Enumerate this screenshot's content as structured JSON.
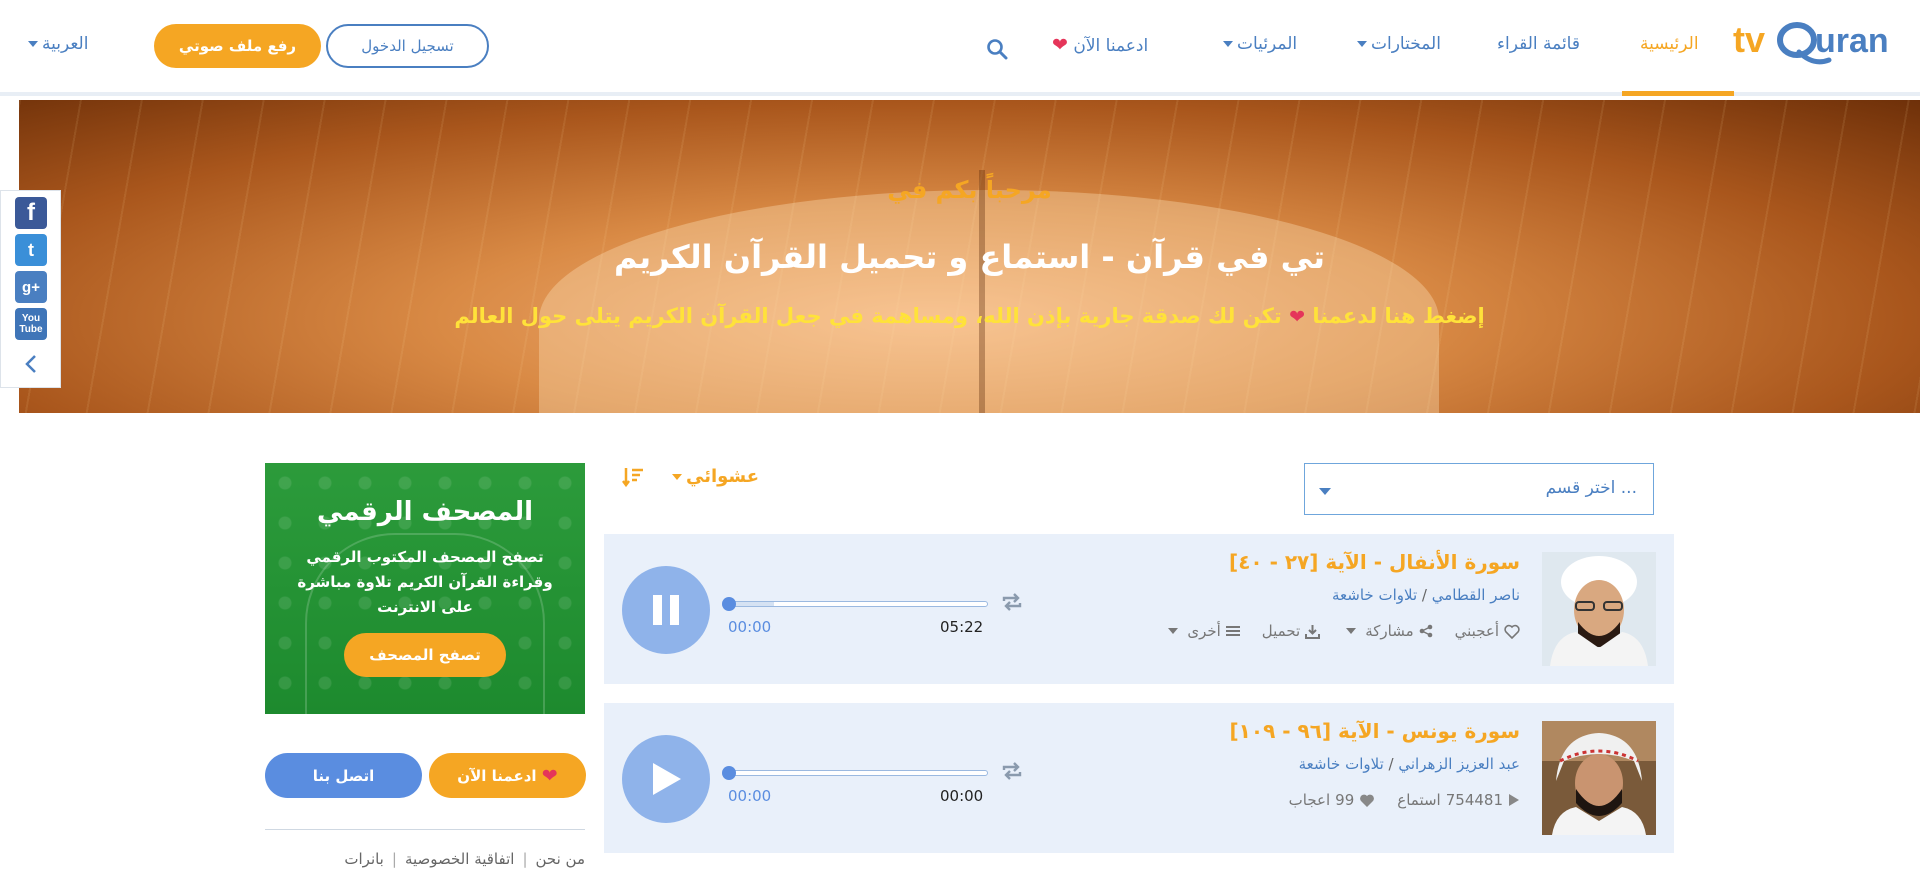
{
  "header": {
    "logo_text": "tvQuran",
    "nav": {
      "home": "الرئيسية",
      "readers": "قائمة القراء",
      "selections": "المختارات",
      "visuals": "المرئيات",
      "support": "ادعمنا الآن"
    },
    "login_label": "تسجيل الدخول",
    "upload_label": "رفع ملف صوتي",
    "language": "العربية"
  },
  "hero": {
    "welcome": "مرحباً بكم في",
    "title": "تي في قرآن - استماع و تحميل القرآن الكريم",
    "support_prefix": "إضغط هنا لدعمنا",
    "support_suffix": "تكن لك صدقة جارية بإذن الله، ومساهمة في جعل القرآن الكريم يتلى حول العالم"
  },
  "social": [
    "facebook",
    "twitter",
    "google-plus",
    "youtube"
  ],
  "sidebar": {
    "mushaf_title": "المصحف الرقمي",
    "mushaf_desc": "تصفح المصحف المكتوب الرقمي وقراءة القرآن الكريم تلاوة مباشرة على الانترنت",
    "mushaf_button": "تصفح المصحف",
    "support_button": "ادعمنا الآن",
    "contact_button": "اتصل بنا",
    "footer_links": [
      "من نحن",
      "اتفاقية الخصوصية",
      "بانرات"
    ]
  },
  "filters": {
    "category_placeholder": "اختر قسم ...",
    "order": "عشوائي"
  },
  "tracks": [
    {
      "title": "سورة الأنفال - الآية [٢٧ - ٤٠]",
      "reciter": "ناصر القطامي",
      "category": "تلاوات خاشعة",
      "like": "أعجبني",
      "share": "مشاركة",
      "download": "تحميل",
      "more": "أخرى",
      "current_time": "00:00",
      "duration": "05:22",
      "state": "playing",
      "buffered_fraction": 0.18
    },
    {
      "title": "سورة يونس - الآية [٩٦ - ١٠٩]",
      "reciter": "عبد العزيز الزهراني",
      "category": "تلاوات خاشعة",
      "listens_count": "754481",
      "listens_label": "استماع",
      "likes_count": "99",
      "likes_label": "اعجاب",
      "current_time": "00:00",
      "duration": "00:00",
      "state": "paused",
      "buffered_fraction": 0
    }
  ],
  "colors": {
    "accent_orange": "#f5a623",
    "link_blue": "#4a7fc1",
    "card_bg": "#e9f0fa",
    "player_blue": "#8fb3ea"
  }
}
